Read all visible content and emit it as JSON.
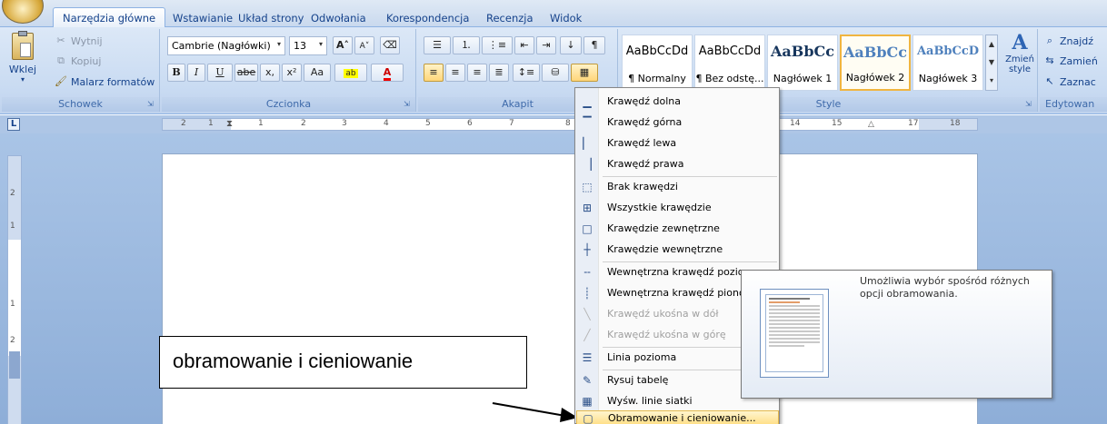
{
  "tabs": [
    {
      "label": "Narzędzia główne",
      "active": true
    },
    {
      "label": "Wstawianie"
    },
    {
      "label": "Układ strony"
    },
    {
      "label": "Odwołania"
    },
    {
      "label": "Korespondencja"
    },
    {
      "label": "Recenzja"
    },
    {
      "label": "Widok"
    }
  ],
  "clipboard": {
    "group_label": "Schowek",
    "paste": "Wklej",
    "cut": "Wytnij",
    "copy": "Kopiuj",
    "format_painter": "Malarz formatów"
  },
  "font": {
    "group_label": "Czcionka",
    "font_name": "Cambrie (Nagłówki)",
    "font_size": "13",
    "bold": "B",
    "italic": "I",
    "underline": "U",
    "strike": "abe",
    "subscript": "x,",
    "superscript": "x²",
    "change_case": "Aa"
  },
  "paragraph": {
    "group_label": "Akapit"
  },
  "styles": {
    "group_label": "Style",
    "items": [
      {
        "sample": "AaBbCcDd",
        "name": "¶ Normalny"
      },
      {
        "sample": "AaBbCcDd",
        "name": "¶ Bez odstę..."
      },
      {
        "sample": "AaBbCc",
        "name": "Nagłówek 1"
      },
      {
        "sample": "AaBbCc",
        "name": "Nagłówek 2",
        "selected": true
      },
      {
        "sample": "AaBbCcD",
        "name": "Nagłówek 3"
      }
    ],
    "change_styles": "Zmień style"
  },
  "editing": {
    "group_label": "Edytowan",
    "find": "Znajdź",
    "replace": "Zamień",
    "select": "Zaznac"
  },
  "ruler": {
    "corner": "L",
    "ticks": [
      "2",
      "1",
      "1",
      "2",
      "3",
      "4",
      "5",
      "6",
      "7",
      "8",
      "14",
      "15",
      "17",
      "18"
    ],
    "vticks": [
      "2",
      "1",
      "1",
      "2"
    ]
  },
  "menu": {
    "items": [
      {
        "icon": "▁",
        "label": "Krawędź dolna"
      },
      {
        "icon": "▔",
        "label": "Krawędź górna"
      },
      {
        "icon": "▏",
        "label": "Krawędź lewa"
      },
      {
        "icon": "▕",
        "label": "Krawędź prawa"
      },
      {
        "icon": "⬚",
        "label": "Brak krawędzi"
      },
      {
        "icon": "⊞",
        "label": "Wszystkie krawędzie"
      },
      {
        "icon": "□",
        "label": "Krawędzie zewnętrzne"
      },
      {
        "icon": "┼",
        "label": "Krawędzie wewnętrzne"
      },
      {
        "icon": "╌",
        "label": "Wewnętrzna krawędź pozio"
      },
      {
        "icon": "┊",
        "label": "Wewnętrzna krawędź piono"
      },
      {
        "icon": "╲",
        "label": "Krawędź ukośna w dół",
        "disabled": true
      },
      {
        "icon": "╱",
        "label": "Krawędź ukośna w górę",
        "disabled": true
      },
      {
        "icon": "☰",
        "label": "Linia pozioma"
      },
      {
        "icon": "✎",
        "label": "Rysuj tabelę"
      },
      {
        "icon": "▦",
        "label": "Wyśw. linie siatki"
      },
      {
        "icon": "▢",
        "label": "Obramowanie i cieniowanie...",
        "highlighted": true
      }
    ]
  },
  "tooltip": {
    "text": "Umożliwia wybór spośród różnych opcji obramowania."
  },
  "callout": {
    "text": "obramowanie i cieniowanie"
  }
}
